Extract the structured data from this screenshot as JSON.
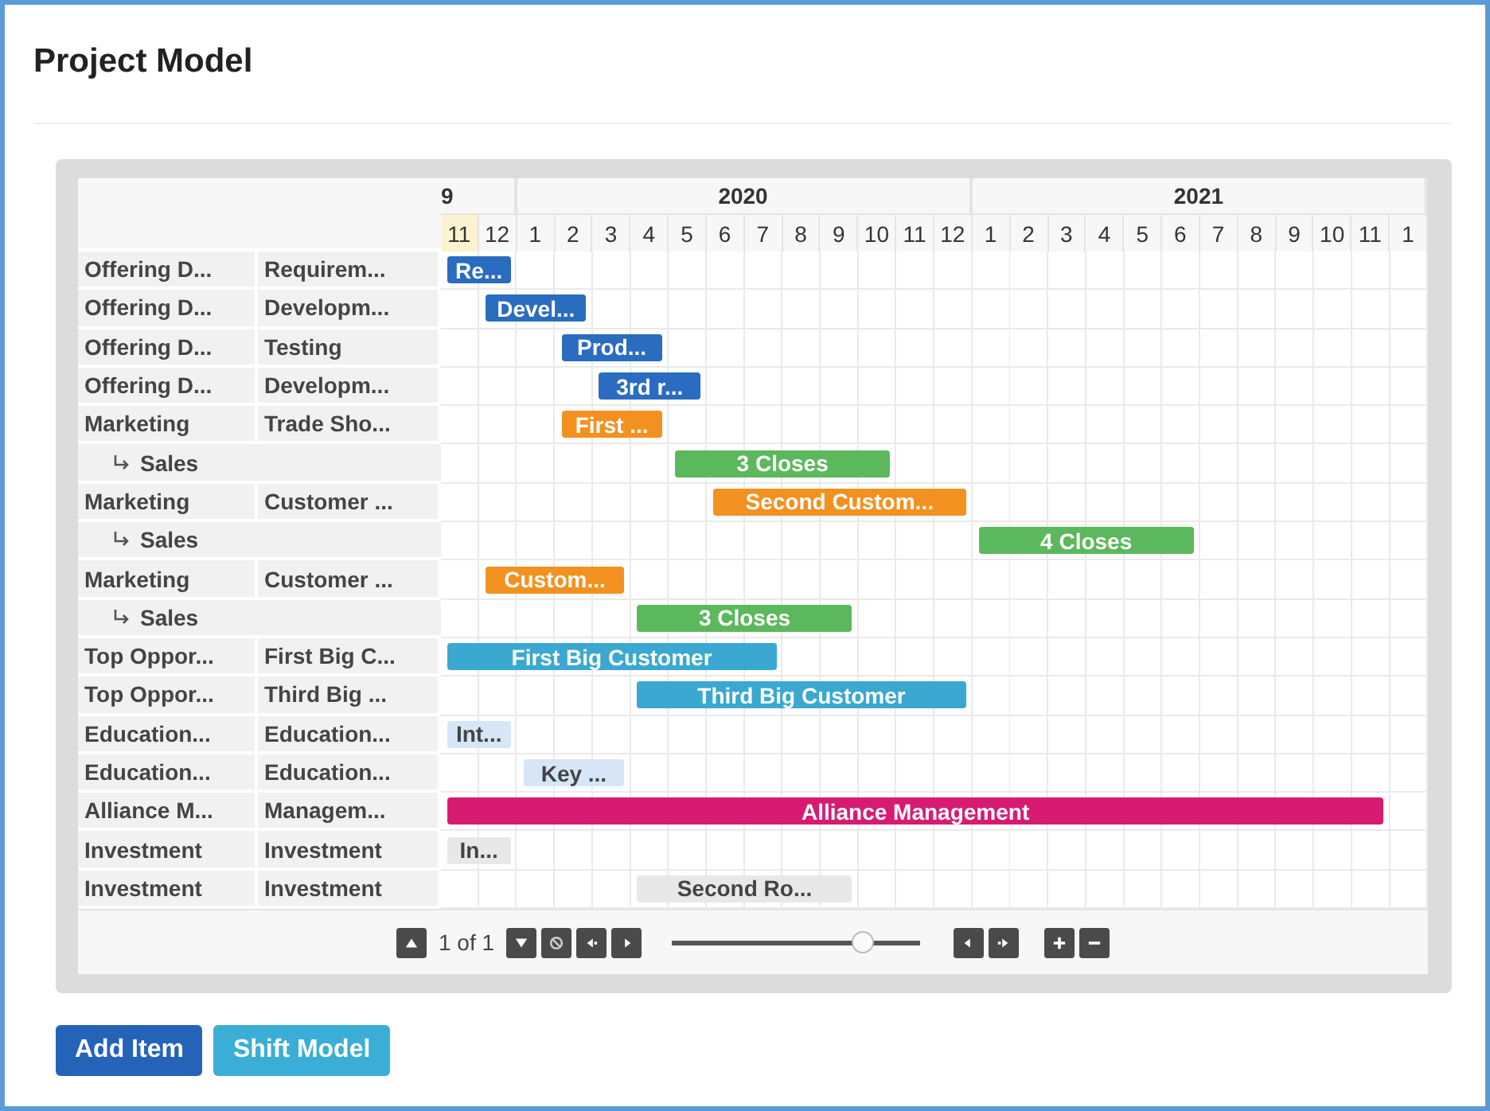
{
  "title": "Project Model",
  "timeline": {
    "years": [
      {
        "label": "9",
        "months": [
          {
            "label": "11",
            "current": true
          },
          {
            "label": "12",
            "current": false
          }
        ]
      },
      {
        "label": "2020",
        "months": [
          {
            "label": "1",
            "current": false
          },
          {
            "label": "2",
            "current": false
          },
          {
            "label": "3",
            "current": false
          },
          {
            "label": "4",
            "current": false
          },
          {
            "label": "5",
            "current": false
          },
          {
            "label": "6",
            "current": false
          },
          {
            "label": "7",
            "current": false
          },
          {
            "label": "8",
            "current": false
          },
          {
            "label": "9",
            "current": false
          },
          {
            "label": "10",
            "current": false
          },
          {
            "label": "11",
            "current": false
          },
          {
            "label": "12",
            "current": false
          }
        ]
      },
      {
        "label": "2021",
        "months": [
          {
            "label": "1",
            "current": false
          },
          {
            "label": "2",
            "current": false
          },
          {
            "label": "3",
            "current": false
          },
          {
            "label": "4",
            "current": false
          },
          {
            "label": "5",
            "current": false
          },
          {
            "label": "6",
            "current": false
          },
          {
            "label": "7",
            "current": false
          },
          {
            "label": "8",
            "current": false
          },
          {
            "label": "9",
            "current": false
          },
          {
            "label": "10",
            "current": false
          },
          {
            "label": "11",
            "current": false
          },
          {
            "label": "1",
            "current": false
          }
        ]
      }
    ]
  },
  "rows": [
    {
      "group": "Offering D...",
      "task": "Requirem...",
      "bar": {
        "label": "Re...",
        "color": "#2a6cbf"
      }
    },
    {
      "group": "Offering D...",
      "task": "Developm...",
      "bar": {
        "label": "Devel...",
        "color": "#2a6cbf"
      }
    },
    {
      "group": "Offering D...",
      "task": "Testing",
      "bar": {
        "label": "Prod...",
        "color": "#2a6cbf"
      }
    },
    {
      "group": "Offering D...",
      "task": "Developm...",
      "bar": {
        "label": "3rd r...",
        "color": "#2a6cbf"
      }
    },
    {
      "group": "Marketing",
      "task": "Trade Sho...",
      "bar": {
        "label": "First ...",
        "color": "#f39120"
      },
      "children": [
        {
          "label": "Sales",
          "bar": {
            "label": "3 Closes",
            "color": "#5cb85c"
          }
        }
      ]
    },
    {
      "group": "Marketing",
      "task": "Customer ...",
      "bar": {
        "label": "Second Custom...",
        "color": "#f39120"
      },
      "children": [
        {
          "label": "Sales",
          "bar": {
            "label": "4 Closes",
            "color": "#5cb85c"
          }
        }
      ]
    },
    {
      "group": "Marketing",
      "task": "Customer ...",
      "bar": {
        "label": "Custom...",
        "color": "#f39120"
      },
      "children": [
        {
          "label": "Sales",
          "bar": {
            "label": "3 Closes",
            "color": "#5cb85c"
          }
        }
      ]
    },
    {
      "group": "Top Oppor...",
      "task": "First Big C...",
      "bar": {
        "label": "First Big Customer",
        "color": "#3aa8d0"
      }
    },
    {
      "group": "Top Oppor...",
      "task": "Third Big ...",
      "bar": {
        "label": "Third Big Customer",
        "color": "#3aa8d0"
      }
    },
    {
      "group": "Education...",
      "task": "Education...",
      "bar": {
        "label": "Int...",
        "color": "#d6e6f6"
      }
    },
    {
      "group": "Education...",
      "task": "Education...",
      "bar": {
        "label": "Key ...",
        "color": "#d6e6f6"
      }
    },
    {
      "group": "Alliance M...",
      "task": "Managem...",
      "bar": {
        "label": "Alliance Management",
        "color": "#d81b72"
      }
    },
    {
      "group": "Investment",
      "task": "Investment",
      "bar": {
        "label": "In...",
        "color": "#e8e8e8"
      }
    },
    {
      "group": "Investment",
      "task": "Investment",
      "bar": {
        "label": "Second Ro...",
        "color": "#e8e8e8"
      }
    }
  ],
  "pager": "1 of 1",
  "zoom": {
    "level": 0.77
  },
  "buttons": [
    {
      "label": "Add Item",
      "kind": "primary"
    },
    {
      "label": "Shift Model",
      "kind": "info"
    }
  ]
}
